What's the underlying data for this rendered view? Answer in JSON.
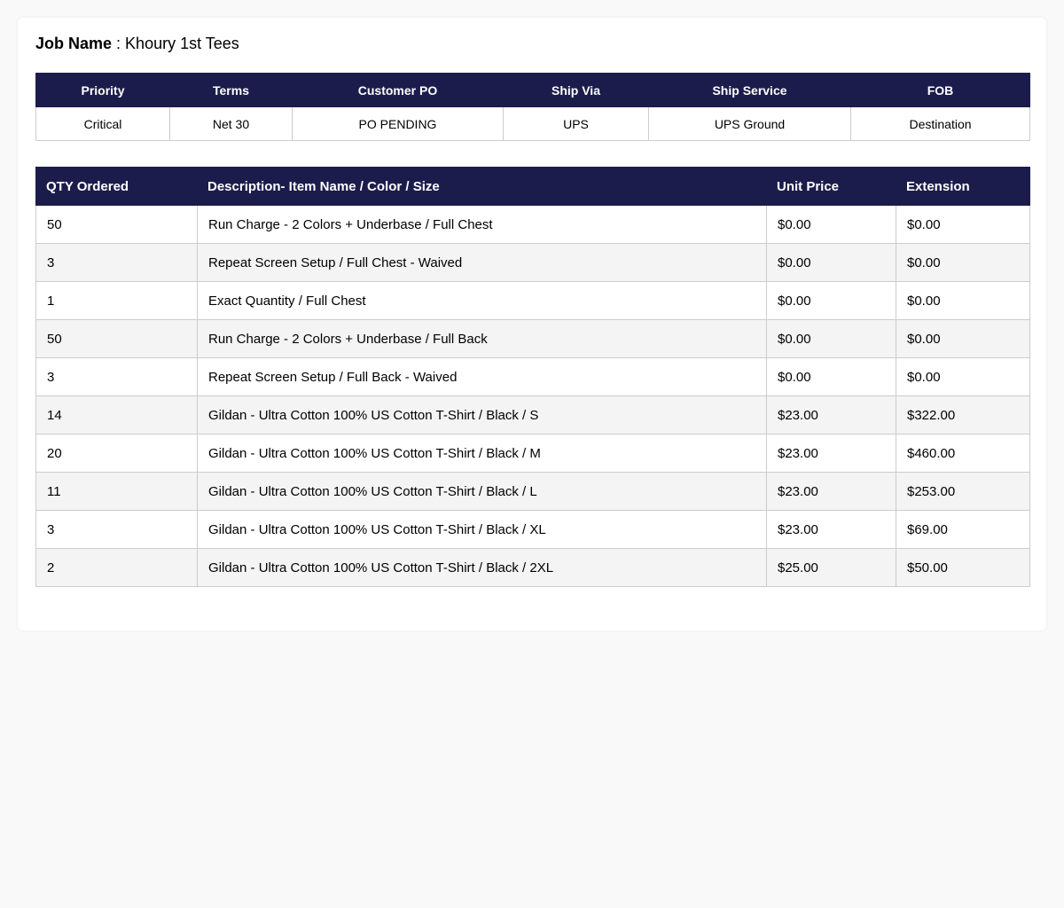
{
  "job": {
    "label": "Job Name",
    "separator": " : ",
    "value": "Khoury 1st Tees"
  },
  "info": {
    "headers": [
      "Priority",
      "Terms",
      "Customer PO",
      "Ship Via",
      "Ship Service",
      "FOB"
    ],
    "values": [
      "Critical",
      "Net 30",
      "PO PENDING",
      "UPS",
      "UPS Ground",
      "Destination"
    ]
  },
  "items": {
    "headers": [
      "QTY Ordered",
      "Description- Item Name / Color / Size",
      "Unit Price",
      "Extension"
    ],
    "rows": [
      [
        "50",
        "Run Charge - 2 Colors + Underbase / Full Chest",
        "$0.00",
        "$0.00"
      ],
      [
        "3",
        "Repeat Screen Setup / Full Chest - Waived",
        "$0.00",
        "$0.00"
      ],
      [
        "1",
        "Exact Quantity / Full Chest",
        "$0.00",
        "$0.00"
      ],
      [
        "50",
        "Run Charge - 2 Colors + Underbase / Full Back",
        "$0.00",
        "$0.00"
      ],
      [
        "3",
        "Repeat Screen Setup / Full Back - Waived",
        "$0.00",
        "$0.00"
      ],
      [
        "14",
        "Gildan - Ultra Cotton 100% US Cotton T-Shirt / Black / S",
        "$23.00",
        "$322.00"
      ],
      [
        "20",
        "Gildan - Ultra Cotton 100% US Cotton T-Shirt / Black / M",
        "$23.00",
        "$460.00"
      ],
      [
        "11",
        "Gildan - Ultra Cotton 100% US Cotton T-Shirt / Black / L",
        "$23.00",
        "$253.00"
      ],
      [
        "3",
        "Gildan - Ultra Cotton 100% US Cotton T-Shirt / Black / XL",
        "$23.00",
        "$69.00"
      ],
      [
        "2",
        "Gildan - Ultra Cotton 100% US Cotton T-Shirt / Black / 2XL",
        "$25.00",
        "$50.00"
      ]
    ]
  },
  "colors": {
    "header_bg": "#1c1c4c",
    "header_text": "#ffffff",
    "row_alt": "#f4f4f4",
    "border": "#cccccc"
  }
}
